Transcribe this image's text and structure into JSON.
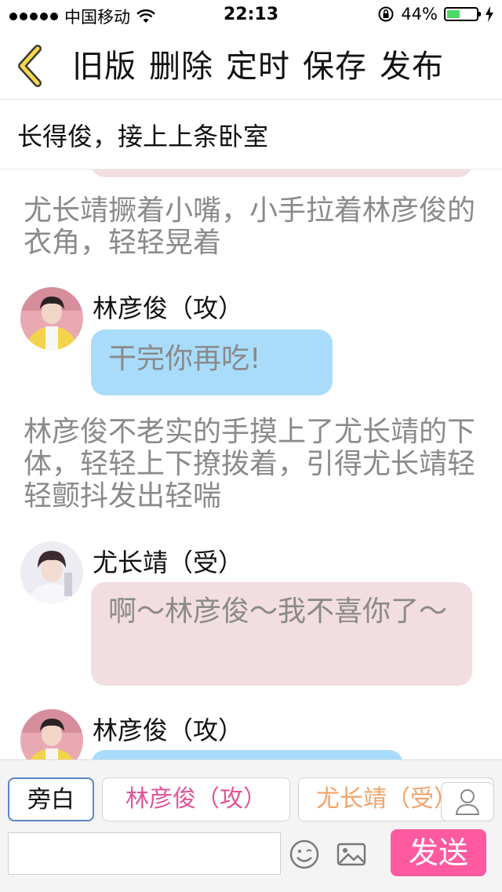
{
  "status_bar": {
    "carrier": "中国移动",
    "time": "22:13",
    "battery_percent": "44%",
    "battery_level": 0.44
  },
  "nav": {
    "back_icon": "chevron-left-icon",
    "actions": [
      "旧版",
      "删除",
      "定时",
      "保存",
      "发布"
    ]
  },
  "title": "长得俊，接上上条卧室",
  "messages": [
    {
      "type": "narration",
      "text": "尤长靖撅着小嘴，小手拉着林彦俊的衣角，轻轻晃着"
    },
    {
      "type": "dialog",
      "speaker": "林彦俊（攻）",
      "text": "干完你再吃!",
      "color": "#a8dcfa"
    },
    {
      "type": "narration",
      "text": "林彦俊不老实的手摸上了尤长靖的下体，轻轻上下撩拨着，引得尤长靖轻轻颤抖发出轻喘"
    },
    {
      "type": "dialog",
      "speaker": "尤长靖（受）",
      "text": "啊～林彦俊～我不喜你了～",
      "color": "#f2dde0"
    },
    {
      "type": "dialog",
      "speaker": "林彦俊（攻）",
      "text": "",
      "color": "#a8dcfa"
    }
  ],
  "composer": {
    "roles": [
      "旁白",
      "林彦俊（攻）",
      "尤长靖（受）"
    ],
    "selected_role": "旁白",
    "input_value": "",
    "send_label": "发送"
  },
  "colors": {
    "accent_pink": "#ff5aa0",
    "bubble_blue": "#a8dcfa",
    "bubble_pink": "#f2dde0",
    "role_pink": "#e0569a",
    "role_orange": "#f2a36a"
  }
}
